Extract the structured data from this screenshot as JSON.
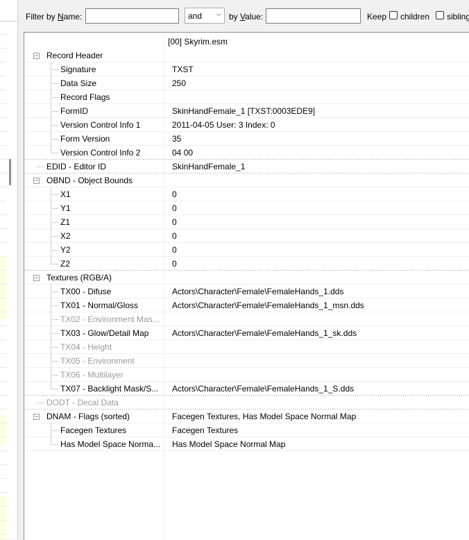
{
  "filter": {
    "name_label_prefix": "Filter by ",
    "name_label_key": "N",
    "name_label_suffix": "ame:",
    "name_value": "",
    "operator": "and",
    "value_label_prefix": "by ",
    "value_label_key": "V",
    "value_label_suffix": "alue:",
    "value_value": "",
    "keep_label": "Keep",
    "children_label": "children",
    "siblings_label": "sibling"
  },
  "tree": {
    "header_value": "[00] Skyrim.esm",
    "rows": [
      {
        "name": "Record Header",
        "value": ""
      },
      {
        "name": "Signature",
        "value": "TXST"
      },
      {
        "name": "Data Size",
        "value": "250"
      },
      {
        "name": "Record Flags",
        "value": ""
      },
      {
        "name": "FormID",
        "value": "SkinHandFemale_1 [TXST:0003EDE9]"
      },
      {
        "name": "Version Control Info 1",
        "value": "2011-04-05 User: 3 Index: 0"
      },
      {
        "name": "Form Version",
        "value": "35"
      },
      {
        "name": "Version Control Info 2",
        "value": "04 00"
      },
      {
        "name": "EDID - Editor ID",
        "value": "SkinHandFemale_1"
      },
      {
        "name": "OBND - Object Bounds",
        "value": ""
      },
      {
        "name": "X1",
        "value": "0"
      },
      {
        "name": "Y1",
        "value": "0"
      },
      {
        "name": "Z1",
        "value": "0"
      },
      {
        "name": "X2",
        "value": "0"
      },
      {
        "name": "Y2",
        "value": "0"
      },
      {
        "name": "Z2",
        "value": "0"
      },
      {
        "name": "Textures (RGB/A)",
        "value": ""
      },
      {
        "name": "TX00 - Difuse",
        "value": "Actors\\Character\\Female\\FemaleHands_1.dds"
      },
      {
        "name": "TX01 - Normal/Gloss",
        "value": "Actors\\Character\\Female\\FemaleHands_1_msn.dds"
      },
      {
        "name": "TX02 - Environment Mas...",
        "value": ""
      },
      {
        "name": "TX03 - Glow/Detail Map",
        "value": "Actors\\Character\\Female\\FemaleHands_1_sk.dds"
      },
      {
        "name": "TX04 - Height",
        "value": ""
      },
      {
        "name": "TX05 - Environment",
        "value": ""
      },
      {
        "name": "TX06 - Multilayer",
        "value": ""
      },
      {
        "name": "TX07 - Backlight Mask/S...",
        "value": "Actors\\Character\\Female\\FemaleHands_1_S.dds"
      },
      {
        "name": "DODT - Decal Data",
        "value": ""
      },
      {
        "name": "DNAM - Flags (sorted)",
        "value": "Facegen Textures, Has Model Space Normal Map"
      },
      {
        "name": "Facegen Textures",
        "value": "Facegen Textures"
      },
      {
        "name": "Has Model Space Norma...",
        "value": "Has Model Space Normal Map"
      }
    ]
  }
}
